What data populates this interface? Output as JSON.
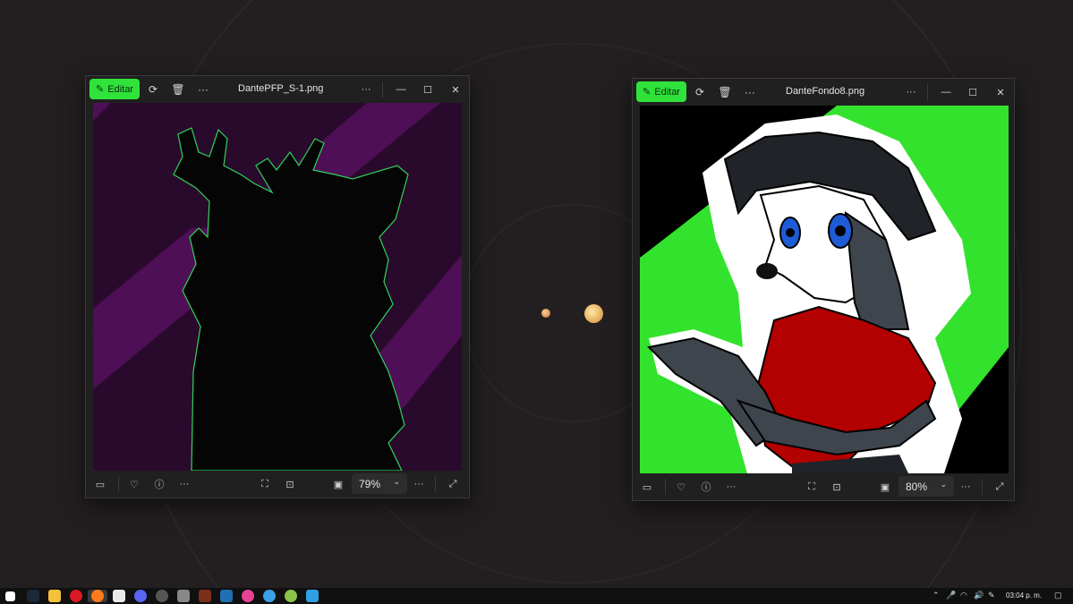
{
  "window1": {
    "edit_label": "Editar",
    "title": "DantePFP_S-1.png",
    "zoom": "79%",
    "bg_color": "#2a0a2c",
    "stripe_color": "#4e0f56",
    "outline_color": "#2fd35e"
  },
  "window2": {
    "edit_label": "Editar",
    "title": "DanteFondo8.png",
    "zoom": "80%",
    "bg_color": "#000000",
    "accent_color": "#33e22d",
    "shirt_color": "#b30000",
    "eye_color": "#1e5bd6"
  },
  "icons": {
    "edit": "pencil-icon",
    "rotate": "rotate-icon",
    "delete": "trash-icon",
    "more": "more-icon",
    "minimize": "minimize-icon",
    "maximize": "maximize-icon",
    "close": "close-icon",
    "filmstrip": "filmstrip-icon",
    "favorite": "heart-icon",
    "info": "info-icon",
    "fit": "fit-icon",
    "ocr": "text-scan-icon",
    "view": "view-icon",
    "expand": "expand-icon"
  },
  "taskbar": {
    "clock": "03:04 p. m."
  },
  "colors": {
    "desktop_bg": "#231f21",
    "window_bg": "#202020",
    "edit_green": "#2fe33b",
    "taskbar_bg": "#101010"
  }
}
